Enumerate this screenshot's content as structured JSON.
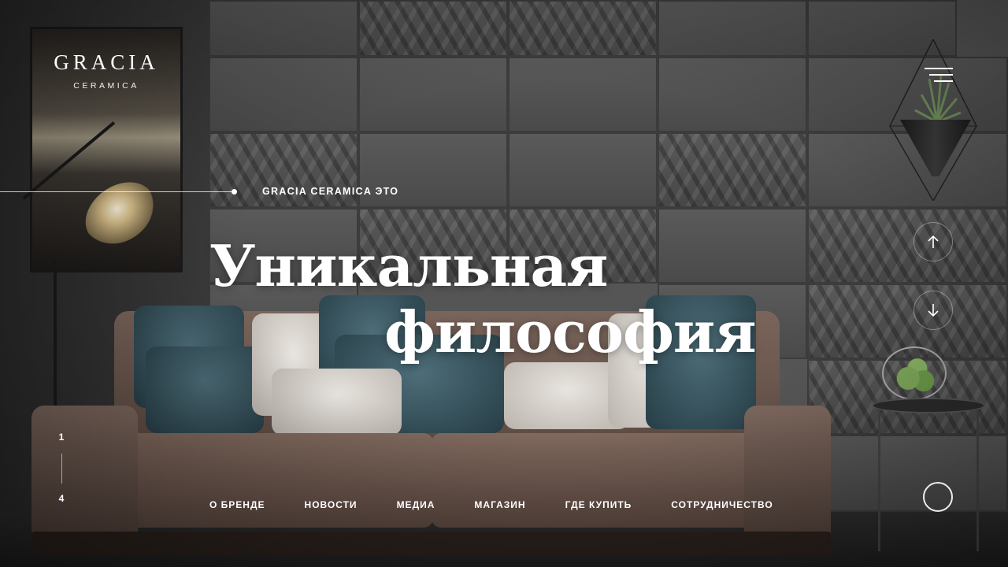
{
  "brand": {
    "name": "GRACIA",
    "subtitle": "CERAMICA"
  },
  "hero": {
    "eyebrow": "GRACIA CERAMICA ЭТО",
    "headline_line1": "Уникальная",
    "headline_line2": "философия"
  },
  "pager": {
    "current": "1",
    "total": "4"
  },
  "nav": {
    "items": [
      {
        "label": "О БРЕНДЕ"
      },
      {
        "label": "НОВОСТИ"
      },
      {
        "label": "МЕДИА"
      },
      {
        "label": "МАГАЗИН"
      },
      {
        "label": "ГДЕ КУПИТЬ"
      },
      {
        "label": "СОТРУДНИЧЕСТВО"
      }
    ]
  },
  "icons": {
    "menu": "hamburger-menu-icon",
    "up": "arrow-up-icon",
    "down": "arrow-down-icon",
    "circle": "circle-icon"
  },
  "colors": {
    "text": "#ffffff",
    "background": "#2a2a2a"
  }
}
